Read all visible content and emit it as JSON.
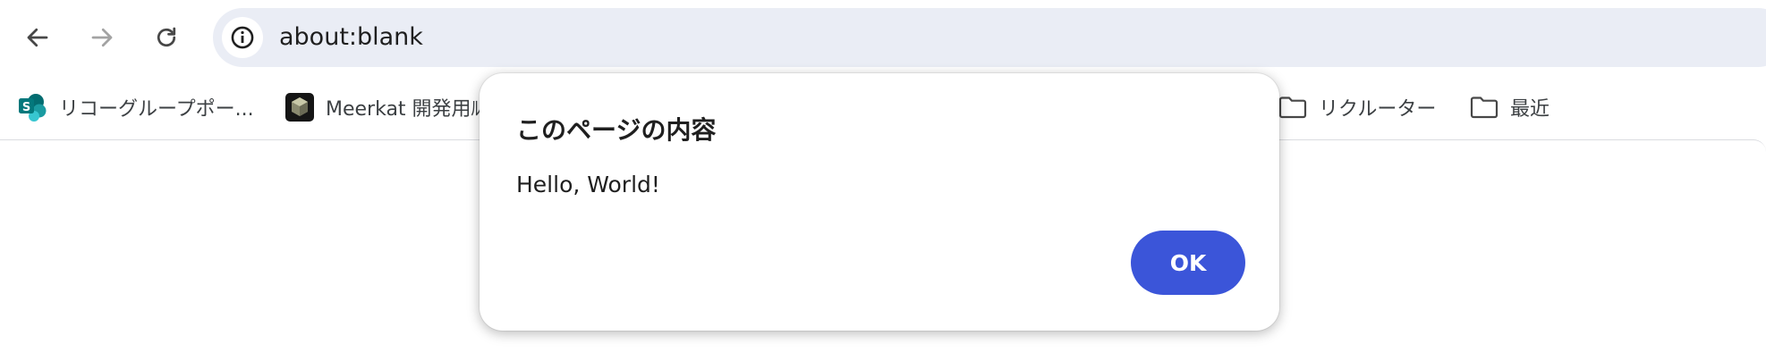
{
  "toolbar": {
    "back_icon": "arrow-left-icon",
    "forward_icon": "arrow-right-icon",
    "reload_icon": "reload-icon",
    "site_info_icon": "info-icon",
    "url": "about:blank"
  },
  "bookmarks": [
    {
      "label": "リコーグループポー...",
      "icon": "sharepoint-icon"
    },
    {
      "label": "Meerkat 開発用ﾙ",
      "icon": "meerkat-cube-icon"
    },
    {
      "label": "リクルーター",
      "icon": "folder-icon"
    },
    {
      "label": "最近",
      "icon": "folder-icon"
    }
  ],
  "dialog": {
    "title": "このページの内容",
    "message": "Hello, World!",
    "ok_label": "OK"
  },
  "colors": {
    "omnibox_bg": "#eaedf5",
    "ok_button_bg": "#3b55d9",
    "text": "#1f1f1f"
  }
}
